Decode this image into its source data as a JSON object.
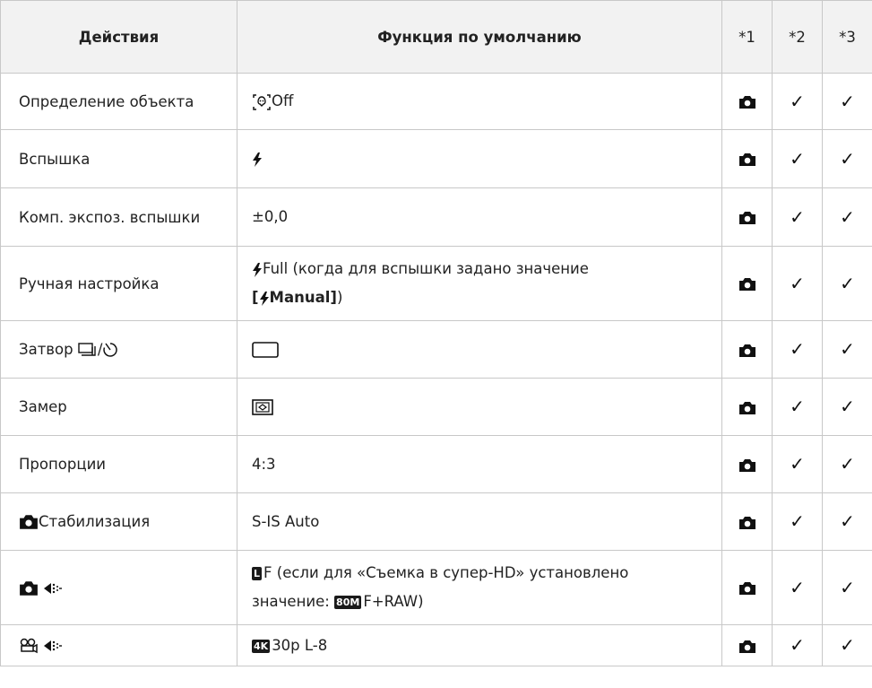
{
  "header": {
    "actions": "Действия",
    "default_function": "Функция по умолчанию",
    "col1": "*1",
    "col2": "*2",
    "col3": "*3"
  },
  "rows": [
    {
      "action": "Определение объекта",
      "default_text": "Off"
    },
    {
      "action": "Вспышка"
    },
    {
      "action": "Комп. экспоз. вспышки",
      "default_text": "±0,0"
    },
    {
      "action": "Ручная настройка",
      "default_text_1": "Full (когда для вспышки задано значение",
      "default_open": "[",
      "default_manual": "Manual]",
      "default_close": ")"
    },
    {
      "action": "Затвор",
      "action_sep": "/"
    },
    {
      "action": "Замер"
    },
    {
      "action": "Пропорции",
      "default_text": "4:3"
    },
    {
      "action": "Стабилизация",
      "default_text": "S-IS Auto"
    },
    {
      "default_badge": "L",
      "default_text_1": "F (если для «Съемка в супер-HD» установлено",
      "default_text_2": "значение: ",
      "default_badge_2": "80M",
      "default_text_3": "F+RAW)"
    },
    {
      "default_badge": "4K",
      "default_text": "30p L-8"
    }
  ],
  "marks": {
    "check": "✓"
  },
  "icons": [
    "subject-detect-icon",
    "flash-icon",
    "drive-icon",
    "self-timer-icon",
    "single-frame-icon",
    "metering-icon",
    "camera-icon",
    "movie-icon",
    "image-quality-icon",
    "check-icon"
  ]
}
